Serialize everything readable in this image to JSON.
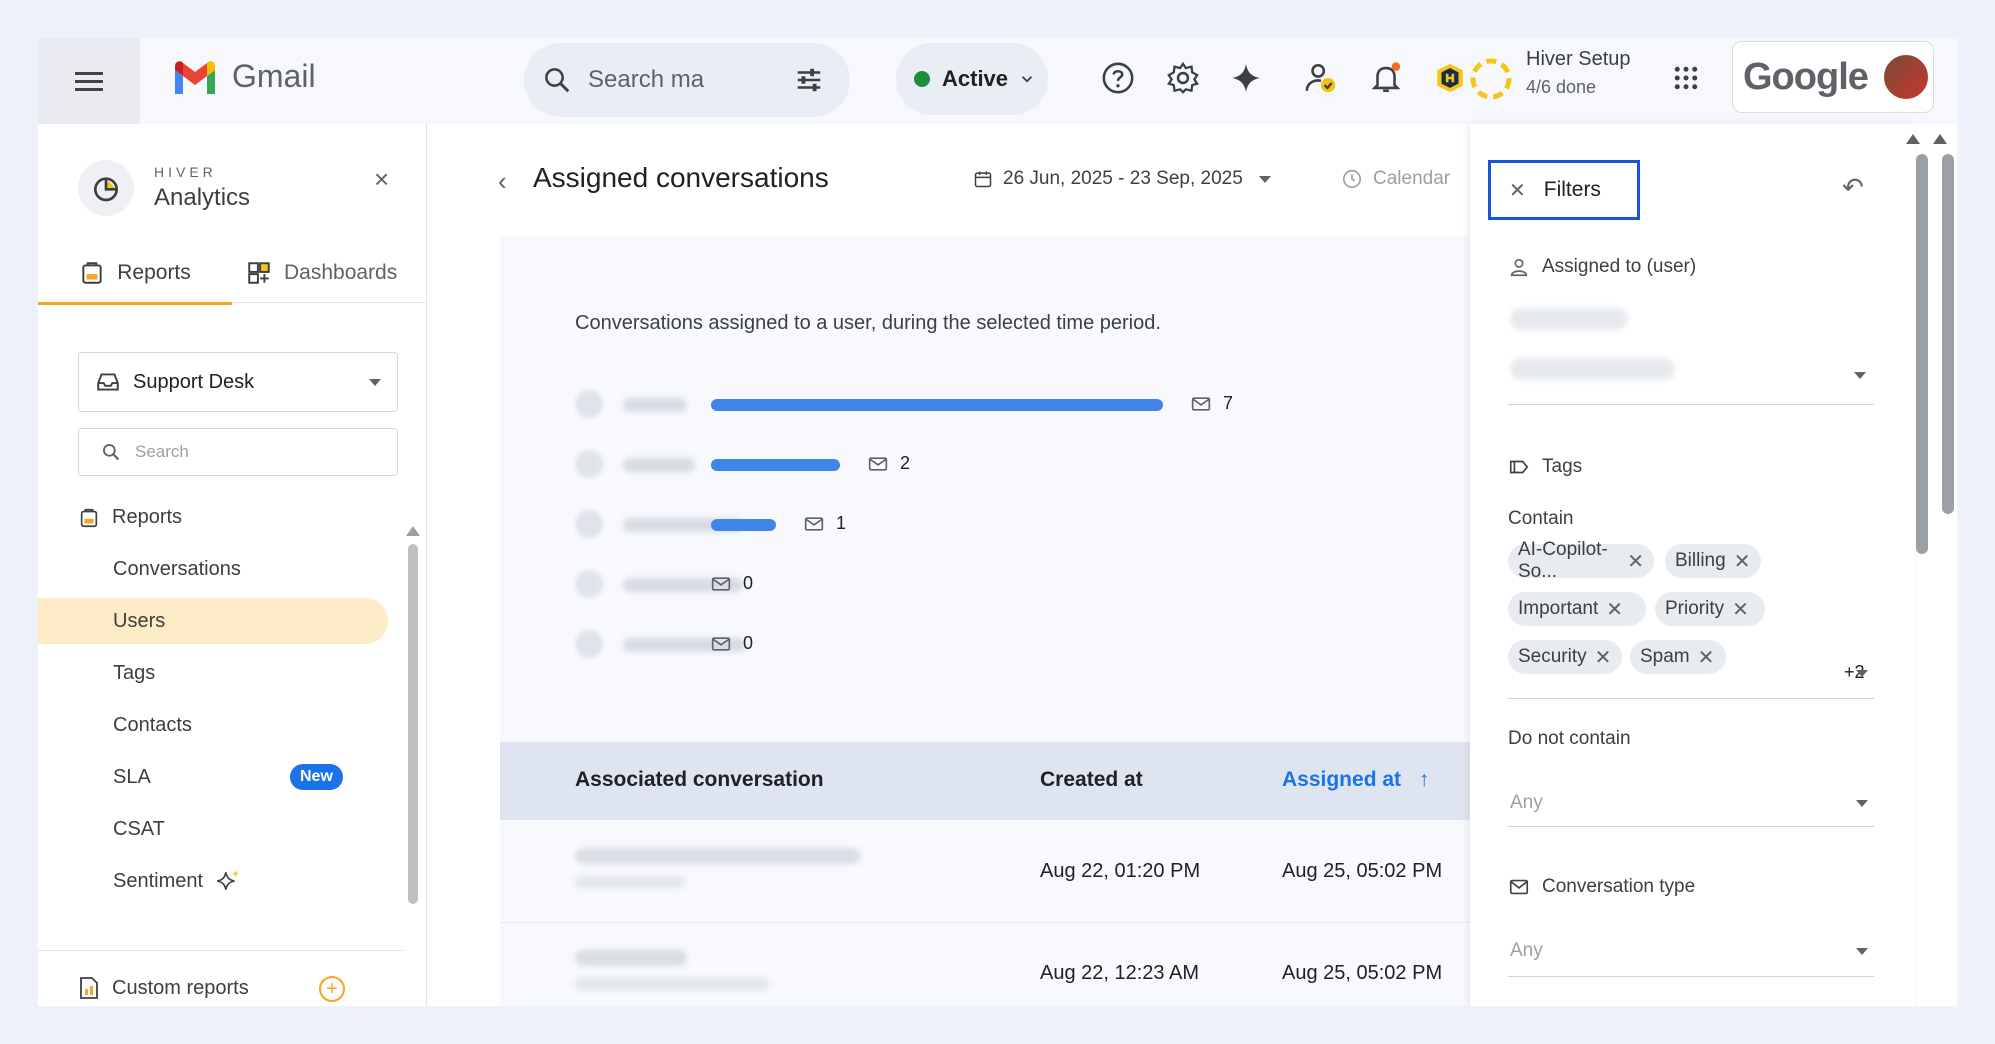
{
  "gmail": {
    "title": "Gmail",
    "search_placeholder": "Search ma",
    "status": "Active"
  },
  "hiver_setup": {
    "title": "Hiver Setup",
    "progress": "4/6 done"
  },
  "google_label": "Google",
  "sidebar": {
    "brand_small": "HIVER",
    "brand_big": "Analytics",
    "close": "×",
    "tabs": [
      {
        "label": "Reports"
      },
      {
        "label": "Dashboards"
      }
    ],
    "inbox_dropdown": "Support Desk",
    "search_placeholder": "Search",
    "section_title": "Reports",
    "items": [
      {
        "label": "Conversations"
      },
      {
        "label": "Users"
      },
      {
        "label": "Tags"
      },
      {
        "label": "Contacts"
      },
      {
        "label": "SLA",
        "badge": "New"
      },
      {
        "label": "CSAT"
      },
      {
        "label": "Sentiment"
      }
    ],
    "custom_reports": "Custom reports",
    "custom_plus": "+"
  },
  "main": {
    "back": "‹",
    "title": "Assigned conversations",
    "date_range": "26 Jun, 2025 - 23 Sep, 2025",
    "calendar_label": "Calendar",
    "description": "Conversations assigned to a user, during the selected time period.",
    "bars": [
      {
        "count": "7",
        "fraction": 1.0
      },
      {
        "count": "2",
        "fraction": 0.286
      },
      {
        "count": "1",
        "fraction": 0.143
      },
      {
        "count": "0",
        "fraction": 0
      },
      {
        "count": "0",
        "fraction": 0
      }
    ],
    "table": {
      "headers": [
        "Associated conversation",
        "Created at",
        "Assigned at",
        "↑"
      ],
      "rows": [
        {
          "created": "Aug 22, 01:20 PM",
          "assigned": "Aug 25, 05:02 PM"
        },
        {
          "created": "Aug 22, 12:23 AM",
          "assigned": "Aug 25, 05:02 PM"
        }
      ]
    }
  },
  "filters": {
    "title": "Filters",
    "close": "✕",
    "undo": "↶",
    "assigned_label": "Assigned to (user)",
    "tags_label": "Tags",
    "contain_label": "Contain",
    "chips": [
      "AI-Copilot-So...",
      "Billing",
      "Important",
      "Priority",
      "Security",
      "Spam"
    ],
    "chip_more": "+2",
    "not_contain_label": "Do not contain",
    "not_contain_placeholder": "Any",
    "conv_type_label": "Conversation type",
    "conv_type_placeholder": "Any"
  },
  "colors": {
    "accent": "#1a73e8",
    "bar": "#4285e8",
    "hiver_orange": "#f5a623",
    "selected_bg": "#fdebc8"
  }
}
